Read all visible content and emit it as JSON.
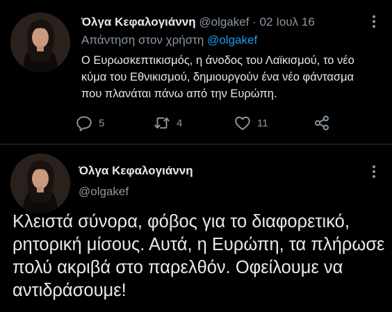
{
  "colors": {
    "background": "#000000",
    "text_primary": "#e7e9ea",
    "text_secondary": "#8b98a5",
    "accent": "#1d9bf0",
    "divider": "#2f3336"
  },
  "reply_tweet": {
    "author_name": "Όλγα Κεφαλογιάννη",
    "handle": "@olgakef",
    "separator": "·",
    "date": "02 Ιουλ 16",
    "reply_prefix": "Απάντηση στον χρήστη",
    "reply_mention": "@olgakef",
    "text": "Ο Ευρωσκεπτικισμός, η άνοδος του Λαϊκισμού, το νέο κύμα του Εθνικισμού, δημιουργούν ένα νέο φάντασμα που πλανάται πάνω από την Ευρώπη.",
    "actions": {
      "reply_icon": "reply-icon",
      "reply_count": "5",
      "retweet_icon": "retweet-icon",
      "retweet_count": "4",
      "like_icon": "heart-icon",
      "like_count": "11",
      "share_icon": "share-icon"
    },
    "more_icon": "more-vertical-icon"
  },
  "main_tweet": {
    "author_name": "Όλγα Κεφαλογιάννη",
    "handle": "@olgakef",
    "text": "Κλειστά σύνορα, φόβος για το διαφορετικό, ρητορική μίσους. Αυτά, η Ευρώπη, τα πλήρωσε πολύ ακριβά στο παρελθόν. Οφείλουμε να αντιδράσουμε!",
    "more_icon": "more-vertical-icon"
  }
}
